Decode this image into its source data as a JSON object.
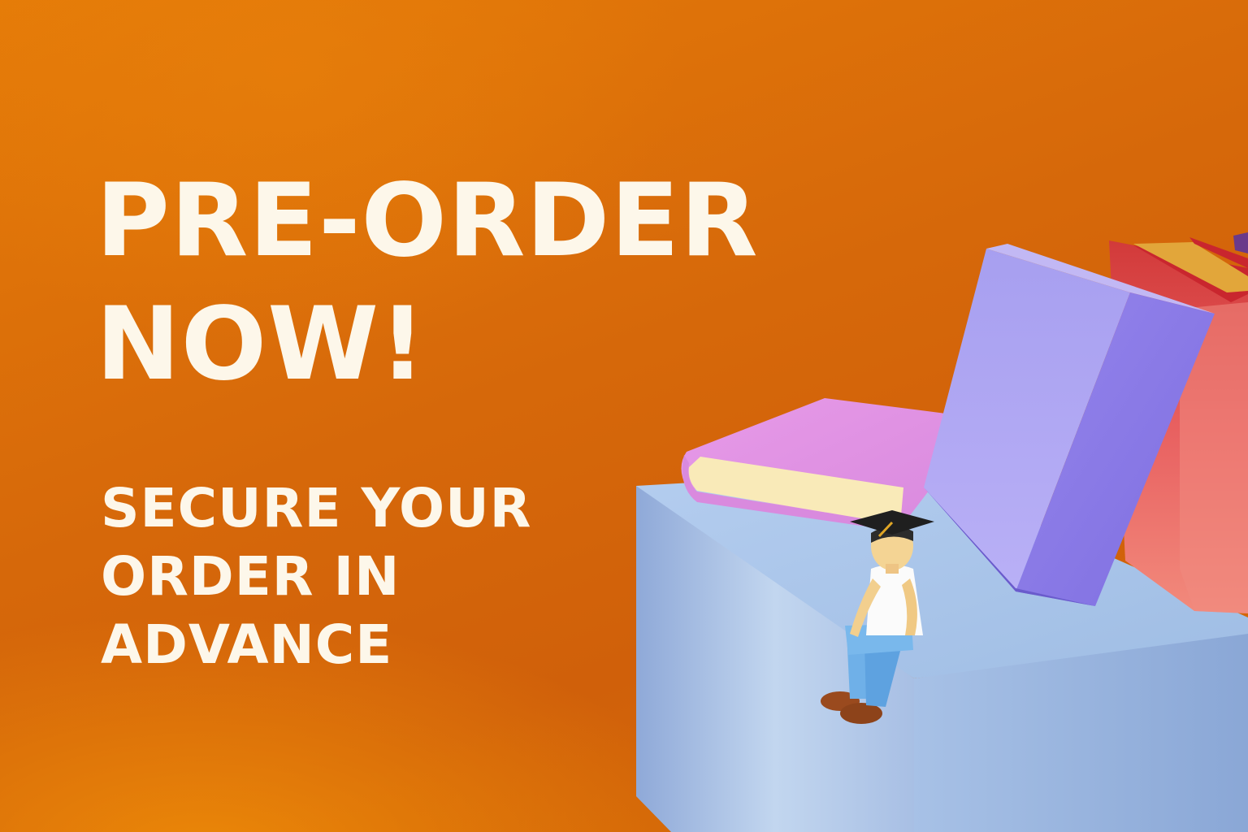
{
  "headline": {
    "line1": "PRE-ORDER",
    "line2": "NOW!"
  },
  "subline": {
    "line1": "SECURE YOUR",
    "line2": "ORDER IN",
    "line3": "ADVANCE"
  },
  "colors": {
    "background": "#d8690a",
    "text": "#fdf7ea",
    "pedestal": "#a9c4e6",
    "lying_book": "#e69ee6",
    "leaning_book": "#a99cee",
    "back_book": "#e86a64"
  },
  "illustration": {
    "icons": [
      "stacked-books-icon",
      "graduation-cap-icon",
      "student-figure-icon",
      "pedestal-block-icon"
    ]
  }
}
